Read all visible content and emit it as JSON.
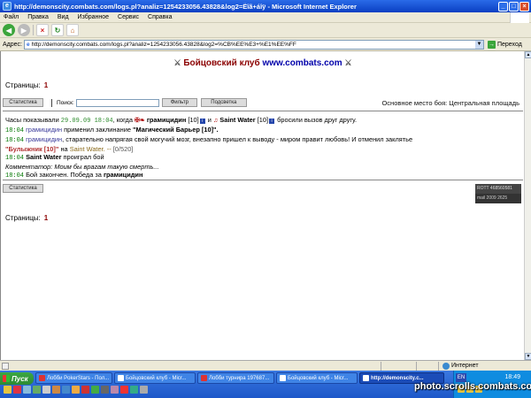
{
  "window": {
    "title": "http://demonscity.combats.com/logs.pl?analiz=1254233056.43828&log2=Ëîã+áîÿ - Microsoft Internet Explorer"
  },
  "menu": [
    "Файл",
    "Правка",
    "Вид",
    "Избранное",
    "Сервис",
    "Справка"
  ],
  "address": {
    "label": "Адрес:",
    "url": "http://demonscity.combats.com/logs.pl?analiz=1254233056.43828&log2=%CB%EE%E3+%E1%EE%FF",
    "go_label": "Переход"
  },
  "header": {
    "club": "Бойцовский клуб",
    "url": "www.combats.com"
  },
  "pages": {
    "label": "Страницы:",
    "current": "1"
  },
  "controls": {
    "stats_label": "Статистика",
    "search_label": "Поиск:",
    "search_value": "",
    "filter_label": "Фильтр",
    "highlight_label": "Подсветка",
    "battle_place": "Основное место боя: Центральная площадь"
  },
  "log": {
    "line1": {
      "prefix": "Часы показывали",
      "time": "29.09.09 18:04",
      "when": ", когда",
      "player1": "грамицидин",
      "p1_level": "[10]",
      "and": "и",
      "player2": "Saint Water",
      "p2_level": "[10]",
      "suffix": "бросили вызов друг другу."
    },
    "line2": {
      "time": "18:04",
      "actor": "грамицидин",
      "text": "применил заклинание",
      "spell": "\"Магический Барьер [10]\"."
    },
    "line3": {
      "time": "18:04",
      "actor": "грамицидин",
      "text": ", старательно напрягая свой могучий мозг, внезапно пришел к выводу - миром правит любовь! И отменил заклятье"
    },
    "line4": {
      "item": "\"Булыжник [10]\"",
      "on": "на",
      "target": "Saint Water",
      "dash": ". --",
      "hp": "[0/520]"
    },
    "line5": {
      "time": "18:04",
      "actor": "Saint Water",
      "text": "проиграл бой"
    },
    "line6": {
      "comment": "Комментатор: Моим бы врагам такую смерть..."
    },
    "line7": {
      "time": "18:04",
      "text": "Бой закончен. Победа за",
      "winner": "грамицидин"
    }
  },
  "counter": {
    "top": "ROTT 468560581",
    "bottom": "mail 2009 2625"
  },
  "statusbar": {
    "zone": "Интернет"
  },
  "taskbar": {
    "start": "Пуск",
    "items": [
      "Лобби PokerStars - Пол...",
      "Бойцовский клуб - Micr...",
      "Лобби турнира 197687...",
      "Бойцовский клуб - Micr...",
      "http://demonscity.c..."
    ],
    "lang": "EN",
    "clock": "18:49"
  },
  "watermark": "photo.scrolls.combats.com"
}
